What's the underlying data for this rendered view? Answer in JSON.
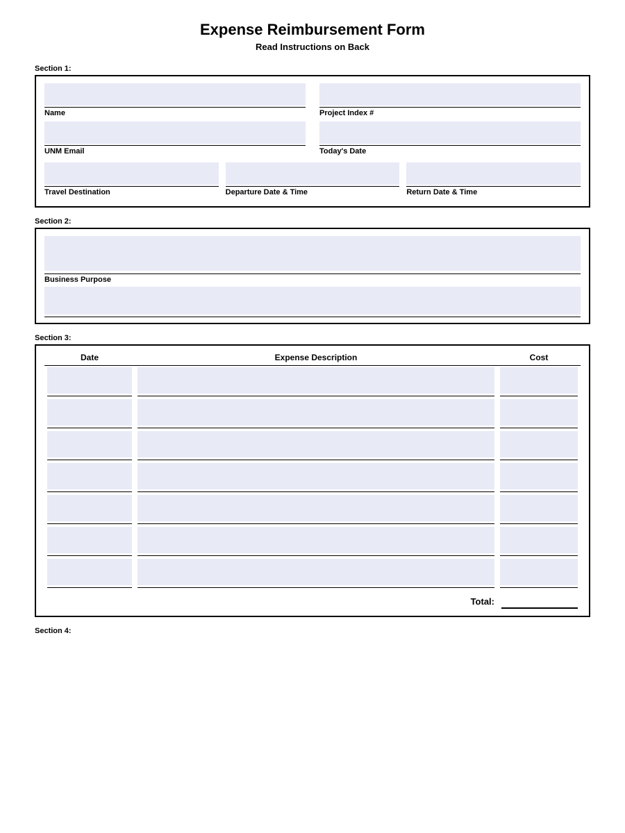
{
  "header": {
    "title": "Expense Reimbursement Form",
    "subtitle": "Read Instructions on Back"
  },
  "section1": {
    "label": "Section 1:",
    "fields": {
      "name_label": "Name",
      "project_index_label": "Project Index #",
      "unm_email_label": "UNM Email",
      "todays_date_label": "Today's Date",
      "travel_destination_label": "Travel Destination",
      "departure_label": "Departure Date & Time",
      "return_label": "Return Date & Time"
    }
  },
  "section2": {
    "label": "Section 2:",
    "fields": {
      "business_purpose_label": "Business Purpose"
    }
  },
  "section3": {
    "label": "Section 3:",
    "col_date": "Date",
    "col_description": "Expense Description",
    "col_cost": "Cost",
    "total_label": "Total:",
    "row_count": 7
  },
  "section4": {
    "label": "Section 4:"
  }
}
